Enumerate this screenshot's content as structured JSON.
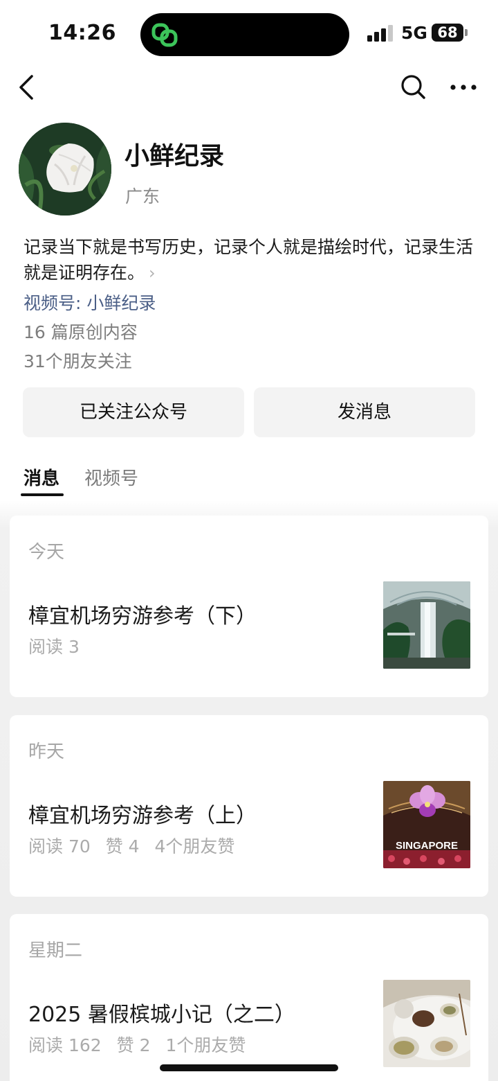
{
  "status_bar": {
    "time": "14:26",
    "network": "5G",
    "battery": "68"
  },
  "nav": {
    "back_icon": "chevron-left-icon",
    "search_icon": "search-icon",
    "more_icon": "more-icon"
  },
  "profile": {
    "name": "小鲜纪录",
    "region": "广东",
    "bio": "记录当下就是书写历史，记录个人就是描绘时代，记录生活就是证明存在。",
    "channel": "视频号: 小鲜纪录",
    "articles": "16 篇原创内容",
    "followers": "31个朋友关注"
  },
  "actions": {
    "follow_label": "已关注公众号",
    "message_label": "发消息"
  },
  "tabs": [
    {
      "label": "消息",
      "active": true
    },
    {
      "label": "视频号",
      "active": false
    }
  ],
  "posts": [
    {
      "date": "今天",
      "title": "樟宜机场穷游参考（下）",
      "meta": [
        "阅读 3"
      ]
    },
    {
      "date": "昨天",
      "title": "樟宜机场穷游参考（上）",
      "meta": [
        "阅读 70",
        "赞 4",
        "4个朋友赞"
      ],
      "thumb_text": "SINGAPORE"
    },
    {
      "date": "星期二",
      "title": "2025 暑假槟城小记（之二）",
      "meta": [
        "阅读 162",
        "赞 2",
        "1个朋友赞"
      ]
    }
  ],
  "colors": {
    "accent_link": "#4a5e86",
    "button_bg": "#f3f3f3",
    "feed_bg": "#ededed",
    "island_icon": "#3cc45a"
  }
}
